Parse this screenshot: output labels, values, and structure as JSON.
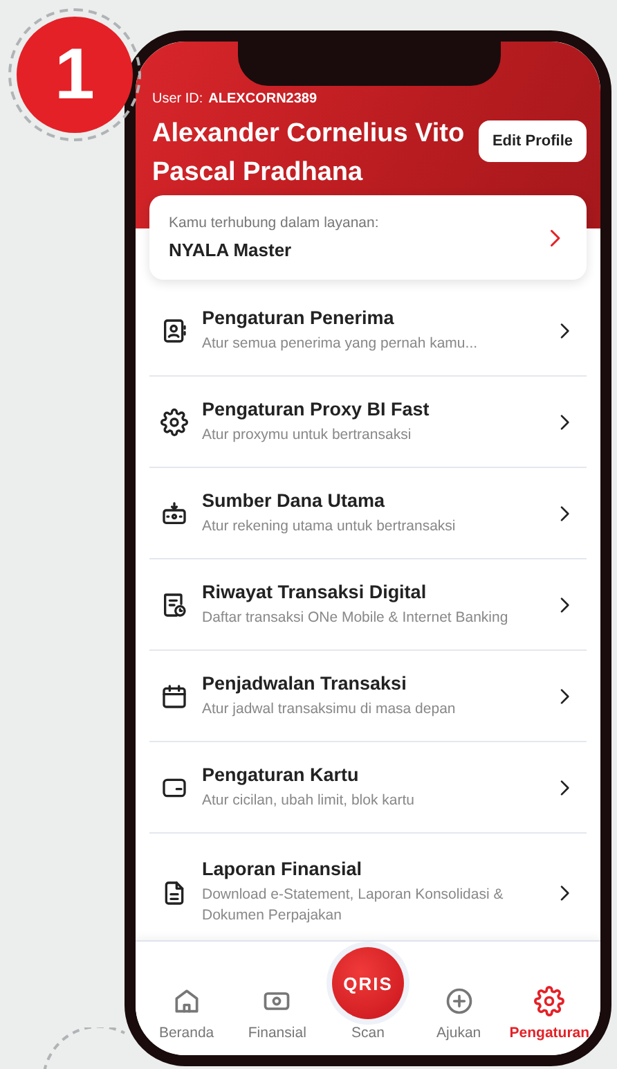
{
  "step_badge": {
    "label": "1"
  },
  "profile": {
    "user_id_label": "User ID:",
    "user_id": "ALEXCORN2389",
    "name": "Alexander Cornelius Vito Pascal Pradhana",
    "edit_button": "Edit Profile"
  },
  "service_card": {
    "caption": "Kamu terhubung dalam layanan:",
    "value": "NYALA Master"
  },
  "menu": [
    {
      "title": "Pengaturan Penerima",
      "subtitle": "Atur semua penerima yang pernah kamu..."
    },
    {
      "title": "Pengaturan Proxy BI Fast",
      "subtitle": "Atur proxymu untuk bertransaksi"
    },
    {
      "title": "Sumber Dana Utama",
      "subtitle": "Atur rekening utama untuk bertransaksi"
    },
    {
      "title": "Riwayat Transaksi Digital",
      "subtitle": "Daftar transaksi ONe Mobile & Internet Banking"
    },
    {
      "title": "Penjadwalan Transaksi",
      "subtitle": "Atur jadwal transaksimu di masa depan"
    },
    {
      "title": "Pengaturan Kartu",
      "subtitle": "Atur cicilan, ubah limit, blok kartu"
    },
    {
      "title": "Laporan Finansial",
      "subtitle": "Download e-Statement, Laporan Konsolidasi & Dokumen Perpajakan"
    }
  ],
  "bottom_nav": [
    {
      "kind": "home",
      "label": "Beranda",
      "selected": false
    },
    {
      "kind": "money",
      "label": "Finansial",
      "selected": false
    },
    {
      "kind": "scan",
      "label": "Scan",
      "logo": "QRIS",
      "selected": false
    },
    {
      "kind": "plus",
      "label": "Ajukan",
      "selected": false
    },
    {
      "kind": "gear",
      "label": "Pengaturan",
      "selected": true
    }
  ]
}
